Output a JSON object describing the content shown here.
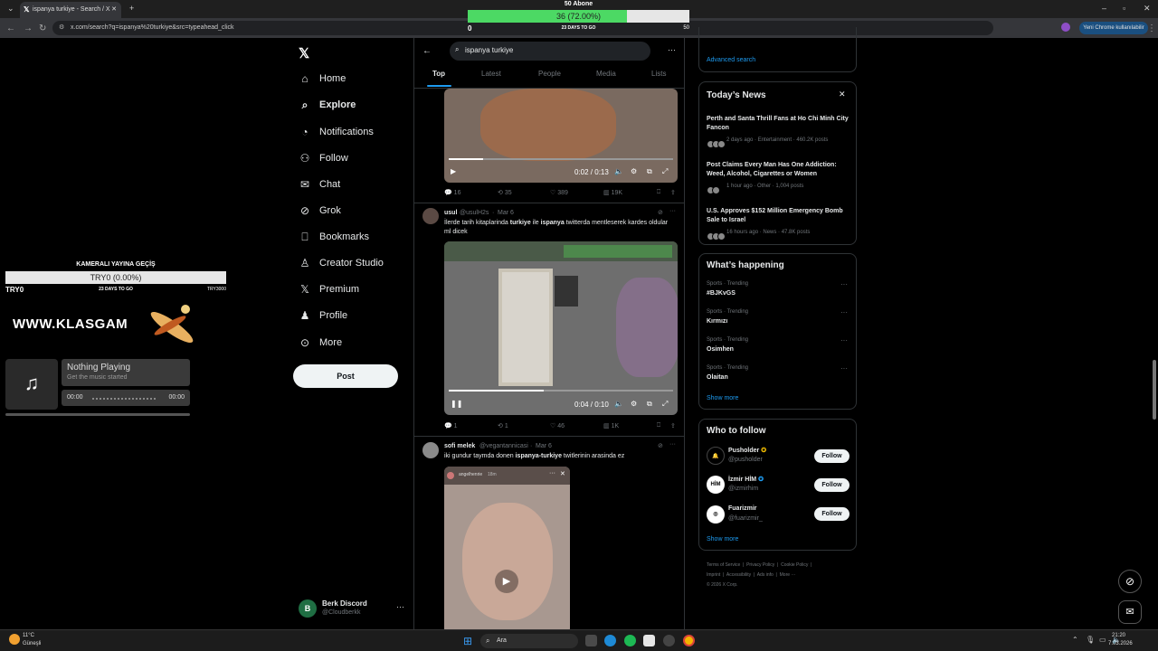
{
  "browser": {
    "tab_title": "ispanya turkiye - Search / X",
    "url": "x.com/search?q=ispanya%20turkiye&src=typeahead_click",
    "chrome_badge": "Yeni Chrome kullanılabilir"
  },
  "sub_goal": {
    "title": "50 Abone",
    "progress_label": "36 (72.00%)",
    "progress_fraction": 0.72,
    "min": "0",
    "days_left": "23 DAYS TO GO",
    "max": "50",
    "fill_color": "#4cd964"
  },
  "cam_goal": {
    "title": "KAMERALI YAYINA GEÇİŞ",
    "progress_label": "TRY0 (0.00%)",
    "progress_fraction": 0,
    "min": "TRY0",
    "days_left": "23 DAYS TO GO",
    "max": "TRY3000"
  },
  "logo_text": "WWW.KLASGAM",
  "music": {
    "title": "Nothing Playing",
    "subtitle": "Get the music started",
    "time_current": "00:00",
    "time_total": "00:00",
    "icon": "music-note-icon"
  },
  "nav": {
    "items": [
      {
        "label": "Home",
        "icon": "home-icon"
      },
      {
        "label": "Explore",
        "icon": "search-icon"
      },
      {
        "label": "Notifications",
        "icon": "bell-icon"
      },
      {
        "label": "Follow",
        "icon": "person-add-icon"
      },
      {
        "label": "Chat",
        "icon": "mail-icon"
      },
      {
        "label": "Grok",
        "icon": "grok-icon"
      },
      {
        "label": "Bookmarks",
        "icon": "bookmark-icon"
      },
      {
        "label": "Creator Studio",
        "icon": "creator-icon"
      },
      {
        "label": "Premium",
        "icon": "x-icon"
      },
      {
        "label": "Profile",
        "icon": "person-icon"
      },
      {
        "label": "More",
        "icon": "more-circle-icon"
      }
    ],
    "post_label": "Post"
  },
  "me": {
    "initial": "B",
    "name": "Berk Discord",
    "handle": "@Cloudberkk"
  },
  "search": {
    "query": "ispanya turkiye",
    "tabs": [
      "Top",
      "Latest",
      "People",
      "Media",
      "Lists"
    ],
    "active_tab": "Top"
  },
  "tweets": [
    {
      "video_time": "0:02 / 0:13",
      "metrics": {
        "replies": "16",
        "reposts": "35",
        "likes": "389",
        "views": "19K"
      }
    },
    {
      "name": "usul",
      "handle": "@usulH2s",
      "date": "Mar 6",
      "text_pre": "İlerde tarih kitaplarinda ",
      "bold1": "turkiye",
      "text_mid": " ile ",
      "bold2": "ispanya",
      "text_post": " twitterda mentleserek kardes oldular ml dicek",
      "video_time": "0:04 / 0:10",
      "metrics": {
        "replies": "1",
        "reposts": "1",
        "likes": "46",
        "views": "1K"
      }
    },
    {
      "name": "sofi melek",
      "handle": "@vegantannicasi",
      "date": "Mar 6",
      "text_pre": "iki gundur taymda donen ",
      "bold1": "ispanya-turkiye",
      "text_post": " twitlerinin arasinda ez",
      "embed_user": "angelhenrie",
      "embed_time": "18m"
    }
  ],
  "right": {
    "advanced_search": "Advanced search",
    "news_title": "Today’s News",
    "news": [
      {
        "title": "Perth and Santa Thrill Fans at Ho Chi Minh City Fancon",
        "meta": "2 days ago · Entertainment · 460.2K posts"
      },
      {
        "title": "Post Claims Every Man Has One Addiction: Weed, Alcohol, Cigarettes or Women",
        "meta": "1 hour ago · Other · 1,004 posts"
      },
      {
        "title": "U.S. Approves $152 Million Emergency Bomb Sale to Israel",
        "meta": "16 hours ago · News · 47.8K posts"
      }
    ],
    "happening_title": "What’s happening",
    "trends": [
      {
        "category": "Sports · Trending",
        "name": "#BJKvGS"
      },
      {
        "category": "Sports · Trending",
        "name": "Kırmızı"
      },
      {
        "category": "Sports · Trending",
        "name": "Osimhen"
      },
      {
        "category": "Sports · Trending",
        "name": "Olaitan"
      }
    ],
    "show_more": "Show more",
    "wtf_title": "Who to follow",
    "wtf": [
      {
        "name": "Pusholder",
        "handle": "@pusholder",
        "verified": "gold"
      },
      {
        "name": "İzmir HİM",
        "handle": "@izmirhim",
        "verified": "blue"
      },
      {
        "name": "Fuarizmir",
        "handle": "@fuarizmir_",
        "verified": "none"
      }
    ],
    "follow_label": "Follow",
    "footer": [
      "Terms of Service",
      "Privacy Policy",
      "Cookie Policy",
      "Imprint",
      "Accessibility",
      "Ads info",
      "More ···",
      "© 2026 X Corp."
    ]
  },
  "taskbar": {
    "temp": "11°C",
    "weather": "Güneşli",
    "search_placeholder": "Ara",
    "time": "21:20",
    "date": "7.03.2026"
  }
}
